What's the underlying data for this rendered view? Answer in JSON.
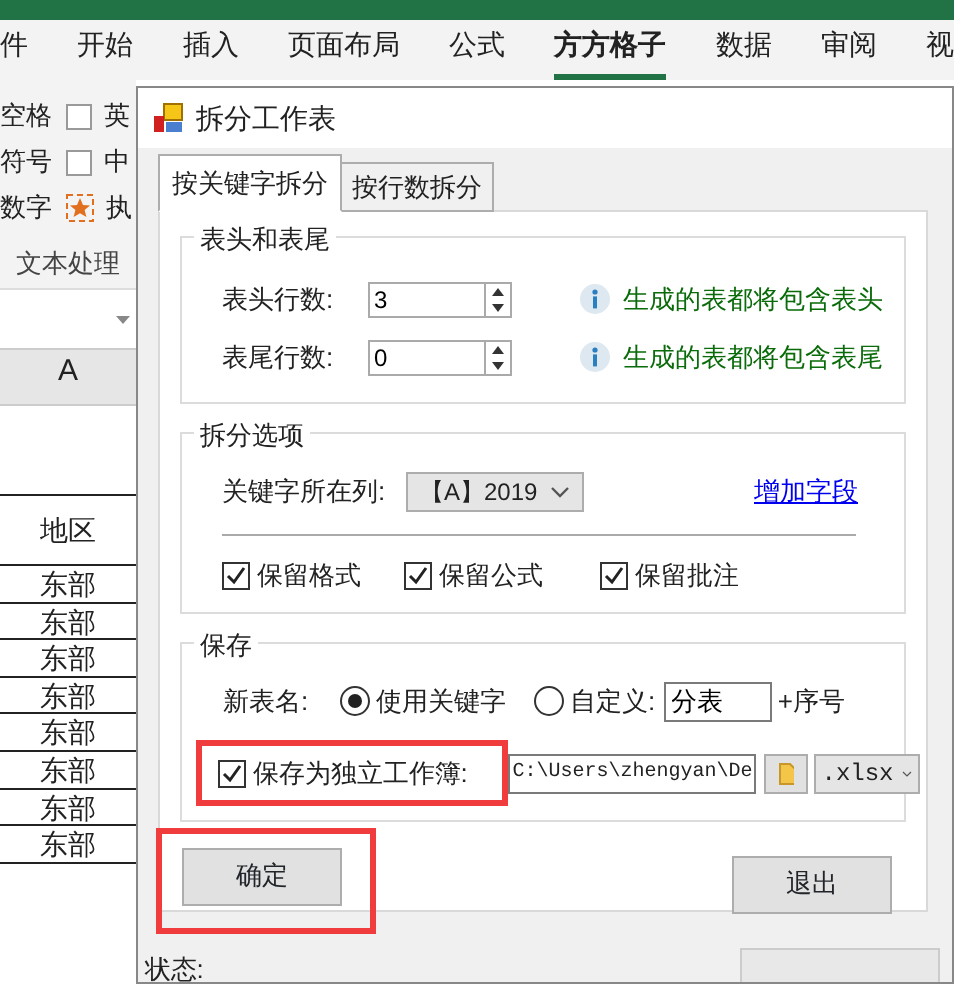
{
  "excel": {
    "ribbon_tabs": [
      {
        "label": "件",
        "selected": false
      },
      {
        "label": "开始",
        "selected": false
      },
      {
        "label": "插入",
        "selected": false
      },
      {
        "label": "页面布局",
        "selected": false
      },
      {
        "label": "公式",
        "selected": false
      },
      {
        "label": "方方格子",
        "selected": true
      },
      {
        "label": "数据",
        "selected": false
      },
      {
        "label": "审阅",
        "selected": false
      },
      {
        "label": "视",
        "selected": false
      }
    ],
    "ribbon_rows": [
      {
        "text": "空格",
        "kind": "checkbox",
        "label": "英",
        "checked": false
      },
      {
        "text": "符号",
        "kind": "checkbox",
        "label": "中",
        "checked": false
      },
      {
        "text": "数字",
        "kind": "command",
        "label": "执"
      }
    ],
    "group_label": "文本处理",
    "column_header": "A",
    "header_cell": "地区",
    "cells": [
      "东部",
      "东部",
      "东部",
      "东部",
      "东部",
      "东部",
      "东部",
      "东部"
    ]
  },
  "dialog": {
    "title": "拆分工作表",
    "tabs": [
      {
        "label": "按关键字拆分",
        "selected": true
      },
      {
        "label": "按行数拆分",
        "selected": false
      }
    ],
    "header_footer": {
      "legend": "表头和表尾",
      "rows": [
        {
          "label": "表头行数:",
          "value": "3",
          "hint": "生成的表都将包含表头"
        },
        {
          "label": "表尾行数:",
          "value": "0",
          "hint": "生成的表都将包含表尾"
        }
      ]
    },
    "split_options": {
      "legend": "拆分选项",
      "key_column_label": "关键字所在列:",
      "key_column_value": "【A】2019",
      "add_field_link": "增加字段",
      "options": [
        {
          "label": "保留格式",
          "checked": true
        },
        {
          "label": "保留公式",
          "checked": true
        },
        {
          "label": "保留批注",
          "checked": true
        }
      ]
    },
    "save": {
      "legend": "保存",
      "name_label": "新表名:",
      "name_modes": [
        {
          "label": "使用关键字",
          "selected": true
        },
        {
          "label": "自定义:",
          "selected": false
        }
      ],
      "custom_name": "分表",
      "suffix": "+序号",
      "workbook": {
        "label": "保存为独立工作簿:",
        "checked": true,
        "highlighted": true,
        "path": "C:\\Users\\zhengyan\\De",
        "format": ".xlsx"
      }
    },
    "buttons": [
      {
        "label": "确定",
        "highlighted": true
      },
      {
        "label": "退出",
        "highlighted": false
      }
    ],
    "status_label": "状态:"
  }
}
